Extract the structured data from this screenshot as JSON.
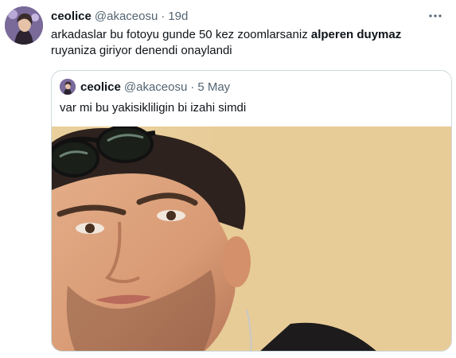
{
  "tweet": {
    "name": "ceolice",
    "handle": "@akaceosu",
    "separator": "·",
    "time": "19d",
    "text_before": "arkadaslar bu fotoyu gunde 50 kez zoomlarsaniz ",
    "text_bold": "alperen duymaz",
    "text_after": " ruyaniza giriyor denendi onaylandi"
  },
  "quote": {
    "name": "ceolice",
    "handle": "@akaceosu",
    "separator": "·",
    "time": "5 May",
    "text": "var mi bu yakisikliligin bi izahi simdi"
  },
  "icons": {
    "more": "more-horizontal-icon"
  },
  "colors": {
    "text_primary": "#0f1419",
    "text_secondary": "#536471",
    "border": "#cfd9de"
  }
}
